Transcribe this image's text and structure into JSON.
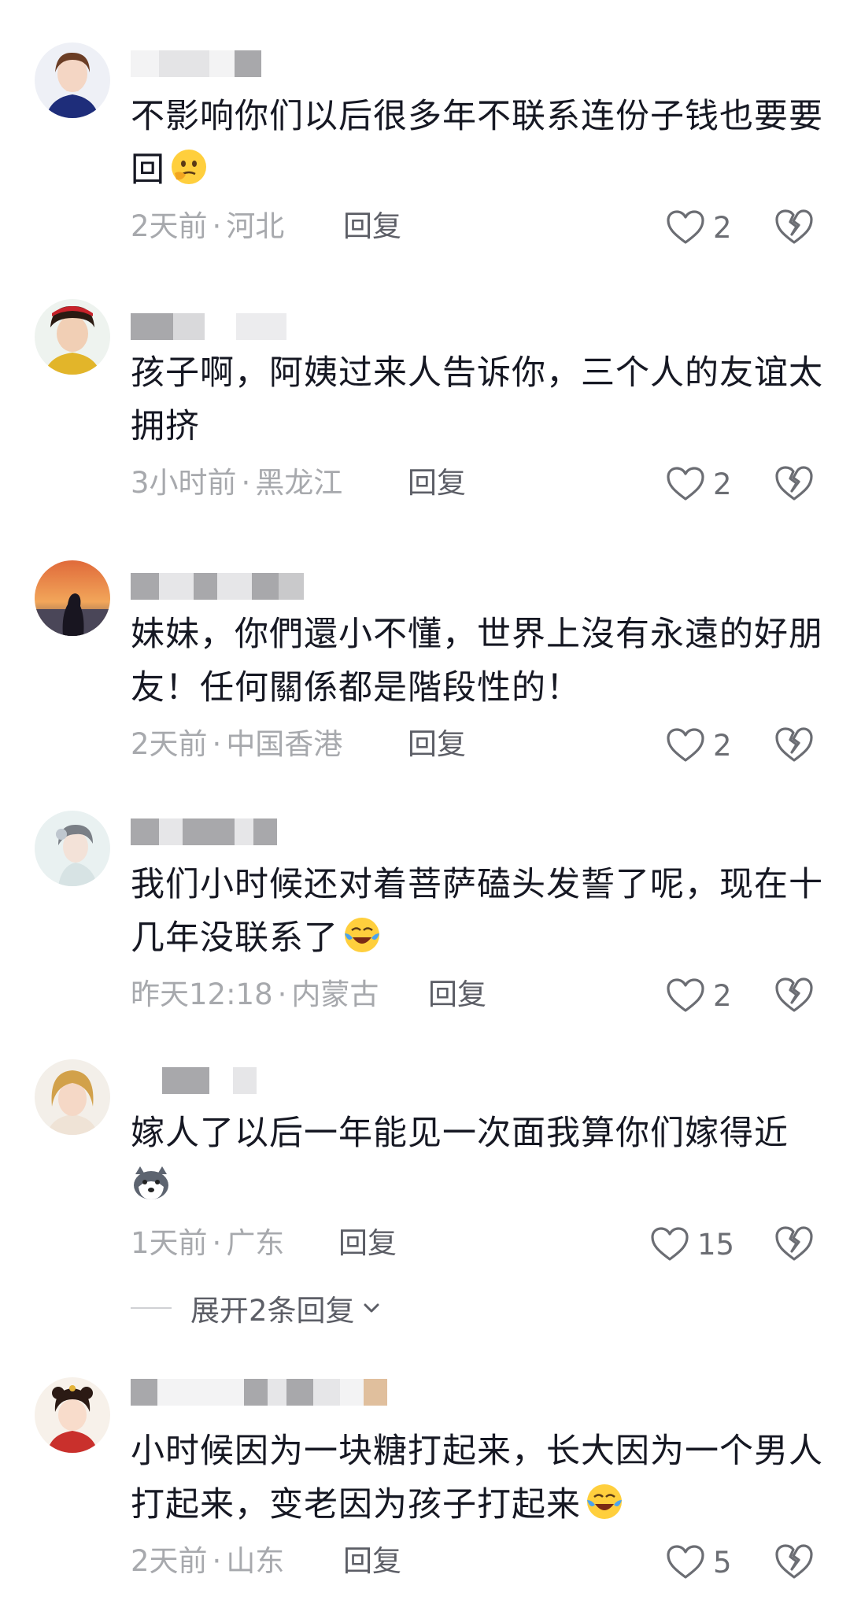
{
  "comments": [
    {
      "text": "不影响你们以后很多年不联系连份子钱也要要回",
      "emoji": "thinking-face-emoji",
      "time": "2天前",
      "location": "河北",
      "reply_label": "回复",
      "likes": "2"
    },
    {
      "text": "孩子啊，阿姨过来人告诉你，三个人的友谊太拥挤",
      "time": "3小时前",
      "location": "黑龙江",
      "reply_label": "回复",
      "likes": "2"
    },
    {
      "text": "妹妹，你們還小不懂，世界上沒有永遠的好朋友！任何關係都是階段性的！",
      "time": "2天前",
      "location": "中国香港",
      "reply_label": "回复",
      "likes": "2"
    },
    {
      "text": "我们小时候还对着菩萨磕头发誓了呢，现在十几年没联系了",
      "emoji": "crying-laughing-emoji",
      "time": "昨天12:18",
      "location": "内蒙古",
      "reply_label": "回复",
      "likes": "2"
    },
    {
      "text": "嫁人了以后一年能见一次面我算你们嫁得近",
      "emoji": "husky-dog-emoji",
      "time": "1天前",
      "location": "广东",
      "reply_label": "回复",
      "likes": "15",
      "expand_label": "展开2条回复"
    },
    {
      "text": "小时候因为一块糖打起来，长大因为一个男人打起来，变老因为孩子打起来",
      "emoji": "crying-laughing-emoji",
      "time": "2天前",
      "location": "山东",
      "reply_label": "回复",
      "likes": "5"
    }
  ],
  "separator": "·",
  "colors": {
    "text": "#161823",
    "meta": "#a7a9ad",
    "reply": "#5c5e66",
    "icon": "#6b6d73"
  }
}
